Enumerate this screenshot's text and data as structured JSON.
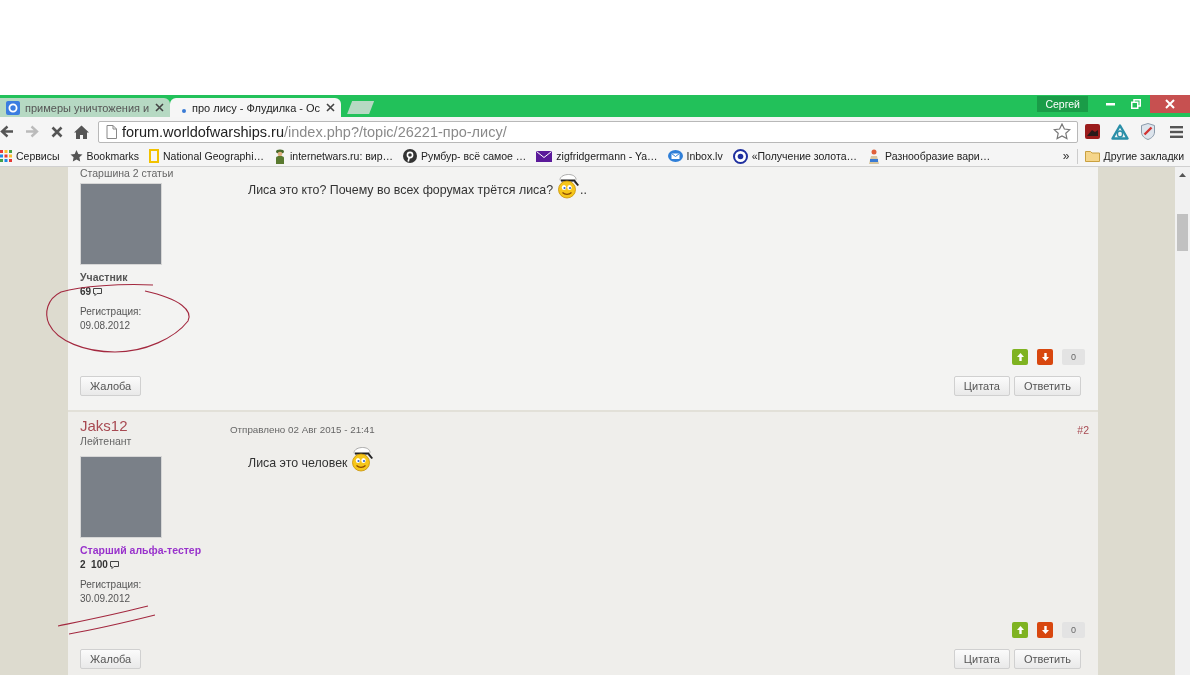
{
  "browser": {
    "tabs": [
      {
        "title": "примеры уничтожения и",
        "selected": false,
        "favicon": {
          "kind": "google"
        }
      },
      {
        "title": "про лису - Флудилка - Ос",
        "selected": true,
        "favicon": {
          "kind": "dot"
        }
      }
    ],
    "profile": "Сергей",
    "nav": [
      {
        "kind": "back",
        "disabled": false
      },
      {
        "kind": "forward",
        "disabled": true
      },
      {
        "kind": "stop",
        "disabled": false
      },
      {
        "kind": "home",
        "disabled": false
      }
    ],
    "address": {
      "host": "forum.worldofwarships.ru",
      "path": "/index.php?/topic/26221-про-лису/"
    },
    "bookmarks": [
      {
        "kind": "apps",
        "label": "Сервисы"
      },
      {
        "kind": "star",
        "label": "Bookmarks"
      },
      {
        "kind": "frame",
        "label": "National Geographi…"
      },
      {
        "kind": "soldier",
        "label": "internetwars.ru: вир…"
      },
      {
        "kind": "pin",
        "label": "Румбур- всё самое …"
      },
      {
        "kind": "mail",
        "label": "zigfridgermann - Ya…"
      },
      {
        "kind": "inbox",
        "label": "Inbox.lv"
      },
      {
        "kind": "coin",
        "label": "«Получение золота…"
      },
      {
        "kind": "figure",
        "label": "Разнообразие вари…"
      }
    ],
    "bookmarks_overflow": "»",
    "other_bookmarks": "Другие закладки"
  },
  "posts": [
    {
      "rank": "Старшина 2 статьи",
      "group": {
        "label": "Участник",
        "color": "#555555"
      },
      "post_count": "69",
      "registered_label": "Регистрация:",
      "registered": "09.08.2012",
      "message": [
        {
          "kind": "text",
          "text": "Лиса это кто? Почему во всех форумах трётся лиса?"
        },
        {
          "kind": "smiley"
        },
        {
          "kind": "text",
          "text": ".."
        }
      ],
      "rating": "0",
      "report": "Жалоба",
      "actions": [
        "Цитата",
        "Ответить"
      ],
      "annotation": {
        "kind": "ellipse"
      }
    },
    {
      "author": "Jaks12",
      "rank": "Лейтенант",
      "posted": "Отправлено 02 Авг 2015 - 21:41",
      "number": "#2",
      "group": {
        "label": "Старший альфа-тестер",
        "color": "#9933cc"
      },
      "post_count": "2  100",
      "registered_label": "Регистрация:",
      "registered": "30.09.2012",
      "message": [
        {
          "kind": "text",
          "text": "Лиса это человек"
        },
        {
          "kind": "smiley"
        }
      ],
      "rating": "0",
      "report": "Жалоба",
      "actions": [
        "Цитата",
        "Ответить"
      ],
      "annotation": {
        "kind": "double-underline"
      }
    }
  ]
}
